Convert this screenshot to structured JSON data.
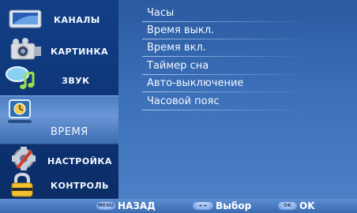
{
  "sidebar": {
    "items": [
      {
        "label": "КАНАЛЫ",
        "icon": "tv-icon"
      },
      {
        "label": "КАРТИНКА",
        "icon": "camera-icon"
      },
      {
        "label": "ЗВУК",
        "icon": "music-icon"
      },
      {
        "label": "ВРЕМЯ",
        "icon": "clock-icon",
        "selected": true
      },
      {
        "label": "НАСТРОЙКА",
        "icon": "gear-icon"
      },
      {
        "label": "КОНТРОЛЬ",
        "icon": "lock-icon"
      }
    ]
  },
  "menu": {
    "items": [
      {
        "label": "Часы"
      },
      {
        "label": "Время выкл."
      },
      {
        "label": "Время вкл."
      },
      {
        "label": "Таймер сна"
      },
      {
        "label": "Авто-выключение"
      },
      {
        "label": "Часовой пояс"
      }
    ]
  },
  "footer": {
    "back": {
      "key": "MENU",
      "label": "НАЗАД"
    },
    "select": {
      "key": "◂◇▸",
      "label": "Выбор"
    },
    "ok": {
      "key": "OK",
      "label": "OK"
    }
  }
}
